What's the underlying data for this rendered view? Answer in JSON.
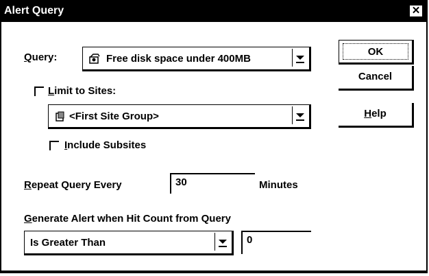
{
  "window": {
    "title": "Alert Query",
    "close": "✕"
  },
  "query": {
    "label_u": "Q",
    "label_rest": "uery:",
    "value": "Free disk space under 400MB"
  },
  "limit": {
    "label_u": "L",
    "label_rest": "imit to Sites:",
    "value": "<First Site Group>"
  },
  "subsites": {
    "label_u": "I",
    "label_rest": "nclude Subsites"
  },
  "repeat": {
    "label_u": "R",
    "label_rest": "epeat Query Every",
    "value": "30",
    "unit": "Minutes"
  },
  "generate": {
    "label_u": "G",
    "label_rest": "enerate Alert when Hit Count from Query"
  },
  "comparison": {
    "value": "Is Greater Than"
  },
  "hitcount": {
    "value": "0"
  },
  "buttons": {
    "ok": "OK",
    "cancel": "Cancel",
    "help_u": "H",
    "help_rest": "elp"
  }
}
